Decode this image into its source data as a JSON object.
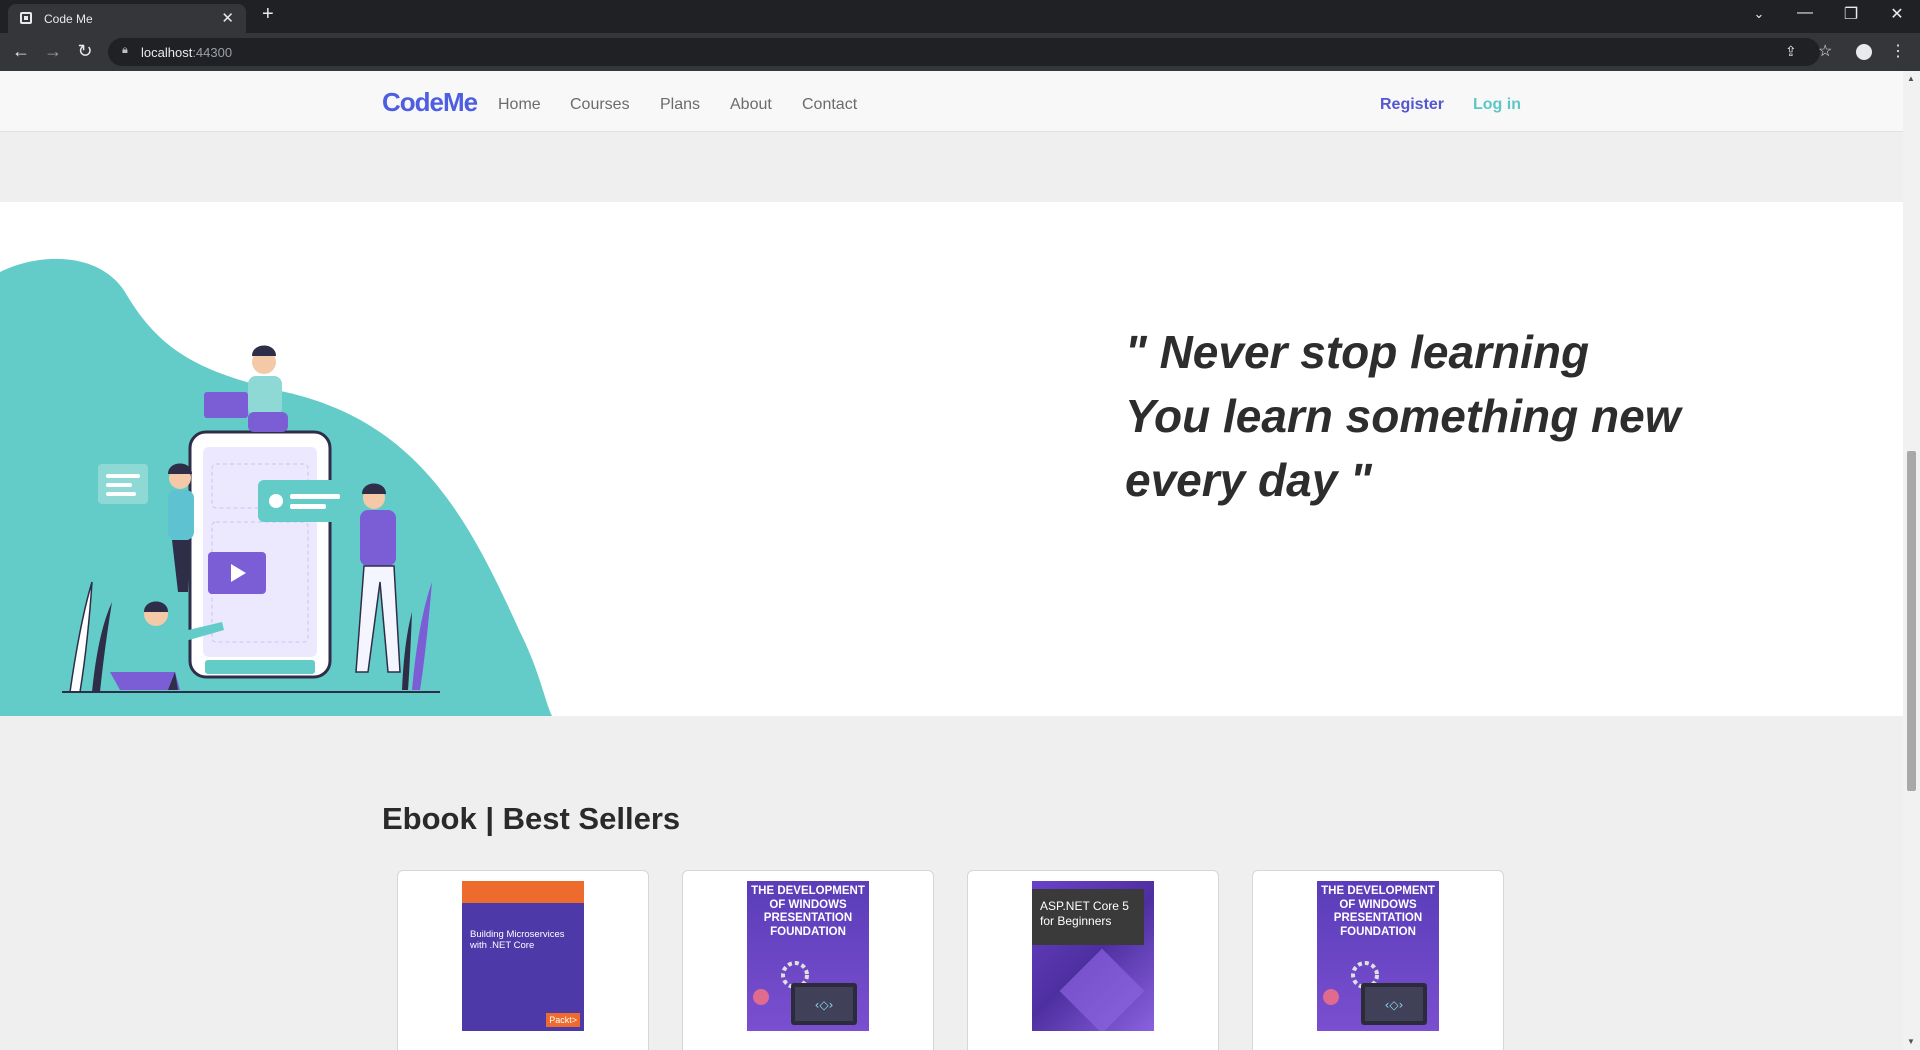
{
  "browser": {
    "tab_title": "Code Me",
    "url_host": "localhost",
    "url_port": ":44300",
    "new_tab_symbol": "+",
    "close_symbol": "✕"
  },
  "site": {
    "brand": "CodeMe",
    "nav": [
      "Home",
      "Courses",
      "Plans",
      "About",
      "Contact"
    ],
    "register_label": "Register",
    "login_label": "Log in",
    "colors": {
      "brand": "#4e5ee0",
      "register": "#5457d0",
      "login": "#5cc7c7",
      "teal": "#63cbc8",
      "purple": "#7b5dd6"
    }
  },
  "hero": {
    "quote_lines": [
      "\" Never stop learning",
      "You learn something new",
      "every day \""
    ]
  },
  "ebooks": {
    "section_title": "Ebook | Best Sellers",
    "books": [
      {
        "cover_style": "packt",
        "cover_title": "Building Microservices with .NET Core",
        "cover_publisher": "Packt>"
      },
      {
        "cover_style": "wpf",
        "cover_title": "THE DEVELOPMENT OF WINDOWS PRESENTATION FOUNDATION"
      },
      {
        "cover_style": "aspnet",
        "cover_title": "ASP.NET Core 5 for Beginners"
      },
      {
        "cover_style": "wpf",
        "cover_title": "THE DEVELOPMENT OF WINDOWS PRESENTATION FOUNDATION"
      }
    ]
  }
}
